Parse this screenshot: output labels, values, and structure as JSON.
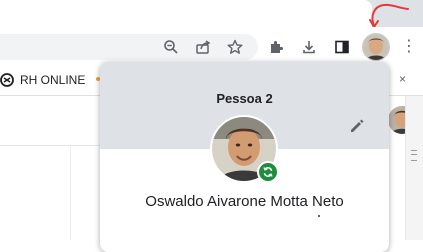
{
  "bookmarks": {
    "items": [
      {
        "label": "RH ONLINE",
        "icon": "rh-online-favicon-icon"
      }
    ]
  },
  "toolbar": {
    "icons": [
      "zoom-out-icon",
      "share-icon",
      "bookmark-star-icon",
      "extensions-icon",
      "download-icon",
      "side-panel-icon",
      "profile-avatar-icon",
      "more-menu-icon"
    ]
  },
  "profile_popup": {
    "title": "Pessoa 2",
    "name": "Oswaldo Aivarone Motta Neto",
    "sync_status_icon": "sync-icon",
    "edit_icon": "pencil-icon",
    "colors": {
      "header": "#dee1e6",
      "sync_badge": "#1e8e3e"
    }
  },
  "annotation": {
    "color": "#e53935"
  }
}
